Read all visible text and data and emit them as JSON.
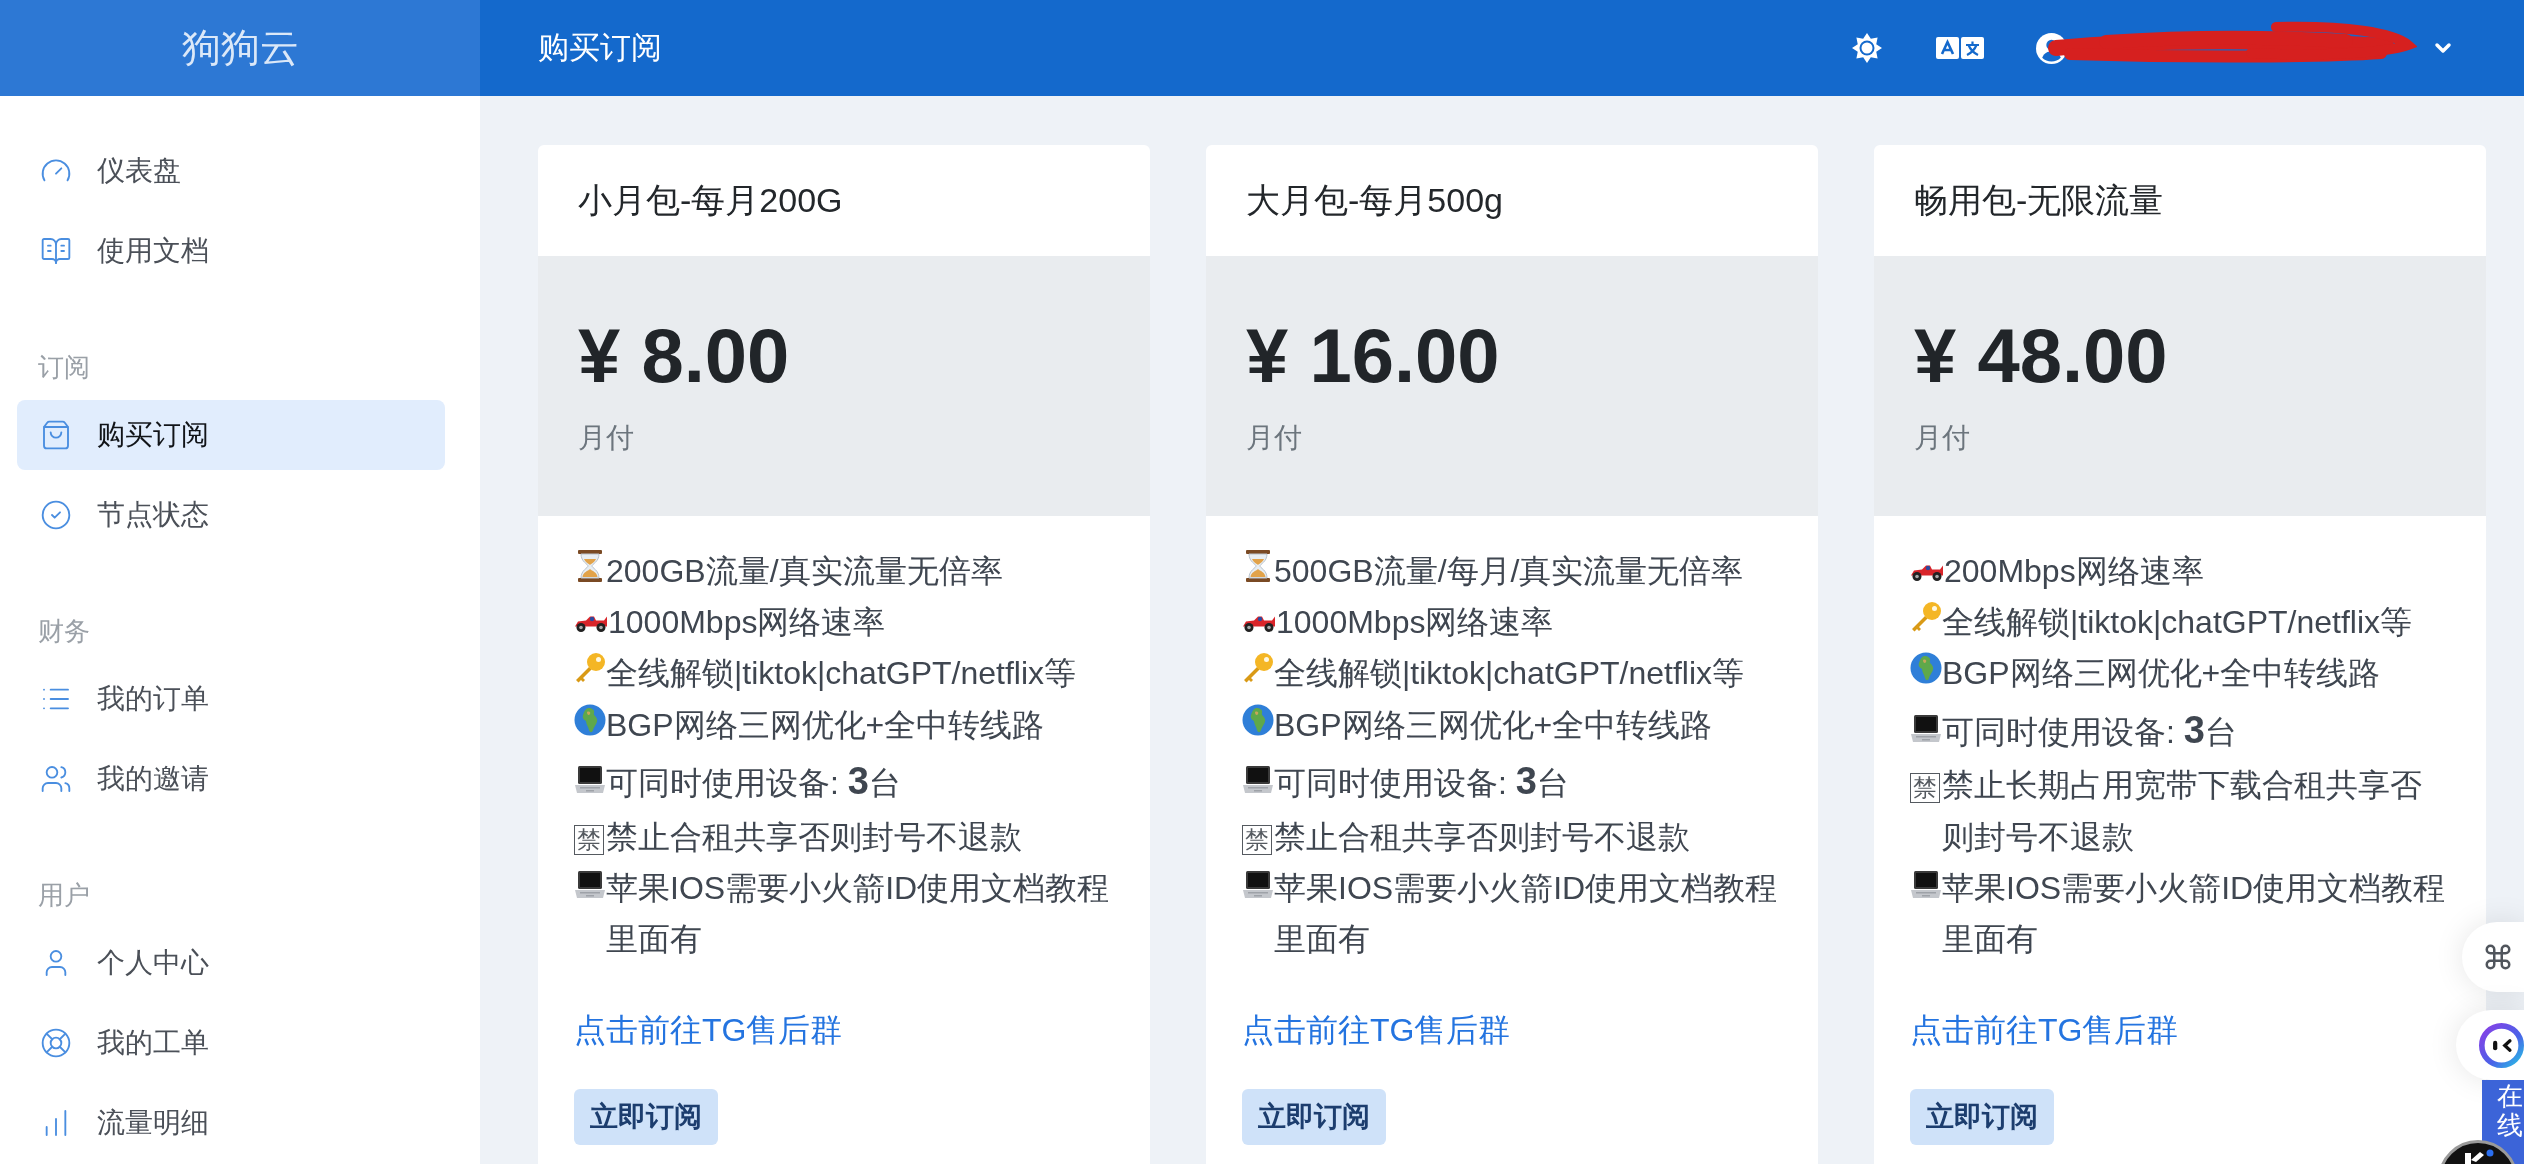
{
  "header": {
    "brand": "狗狗云",
    "title": "购买订阅"
  },
  "sidebar": {
    "groups": [
      {
        "items": [
          {
            "label": "仪表盘",
            "selected": false
          },
          {
            "label": "使用文档",
            "selected": false
          }
        ]
      },
      {
        "label": "订阅",
        "items": [
          {
            "label": "购买订阅",
            "selected": true
          },
          {
            "label": "节点状态",
            "selected": false
          }
        ]
      },
      {
        "label": "财务",
        "items": [
          {
            "label": "我的订单",
            "selected": false
          },
          {
            "label": "我的邀请",
            "selected": false
          }
        ]
      },
      {
        "label": "用户",
        "items": [
          {
            "label": "个人中心",
            "selected": false
          },
          {
            "label": "我的工单",
            "selected": false
          },
          {
            "label": "流量明细",
            "selected": false
          }
        ]
      }
    ]
  },
  "plans": [
    {
      "name": "小月包-每月200G",
      "price": "¥ 8.00",
      "period": "月付",
      "features": [
        {
          "kind": "hourglass",
          "text": "200GB流量/真实流量无倍率"
        },
        {
          "kind": "car",
          "text": "1000Mbps网络速率"
        },
        {
          "kind": "key",
          "text": "全线解锁|tiktok|chatGPT/netflix等"
        },
        {
          "kind": "globe",
          "text": "BGP网络三网优化+全中转线路"
        },
        {
          "kind": "laptop",
          "text": "可同时使用设备: **3**台"
        },
        {
          "kind": "sign",
          "sign": "禁",
          "text": "禁止合租共享否则封号不退款"
        },
        {
          "kind": "laptop",
          "text": "苹果IOS需要小火箭ID使用文档教程里面有"
        }
      ],
      "link": "点击前往TG售后群",
      "button": "立即订阅"
    },
    {
      "name": "大月包-每月500g",
      "price": "¥ 16.00",
      "period": "月付",
      "features": [
        {
          "kind": "hourglass",
          "text": "500GB流量/每月/真实流量无倍率"
        },
        {
          "kind": "car",
          "text": "1000Mbps网络速率"
        },
        {
          "kind": "key",
          "text": "全线解锁|tiktok|chatGPT/netflix等"
        },
        {
          "kind": "globe",
          "text": "BGP网络三网优化+全中转线路"
        },
        {
          "kind": "laptop",
          "text": "可同时使用设备: **3**台"
        },
        {
          "kind": "sign",
          "sign": "禁",
          "text": "禁止合租共享否则封号不退款"
        },
        {
          "kind": "laptop",
          "text": "苹果IOS需要小火箭ID使用文档教程里面有"
        }
      ],
      "link": "点击前往TG售后群",
      "button": "立即订阅"
    },
    {
      "name": "畅用包-无限流量",
      "price": "¥ 48.00",
      "period": "月付",
      "features": [
        {
          "kind": "car",
          "text": "200Mbps网络速率"
        },
        {
          "kind": "key",
          "text": "全线解锁|tiktok|chatGPT/netflix等"
        },
        {
          "kind": "globe",
          "text": "BGP网络三网优化+全中转线路"
        },
        {
          "kind": "laptop",
          "text": "可同时使用设备: **3**台"
        },
        {
          "kind": "sign",
          "sign": "禁",
          "text": "禁止长期占用宽带下载合租共享否则封号不退款"
        },
        {
          "kind": "laptop",
          "text": "苹果IOS需要小火箭ID使用文档教程里面有"
        }
      ],
      "link": "点击前往TG售后群",
      "button": "立即订阅"
    }
  ],
  "chat_tab": {
    "label": "在线"
  }
}
